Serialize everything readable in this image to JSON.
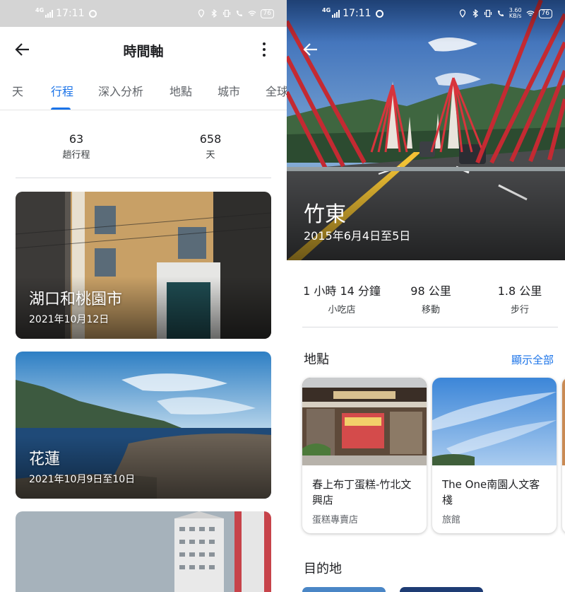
{
  "status_bar_left": {
    "network": "4G",
    "time": "17:11",
    "battery": "76"
  },
  "status_bar_right": {
    "network": "4G",
    "time": "17:11",
    "speed_value": "3.60",
    "speed_unit": "KB/s",
    "battery": "76"
  },
  "timeline": {
    "title": "時間軸",
    "tabs": [
      {
        "label": "天"
      },
      {
        "label": "行程",
        "active": true
      },
      {
        "label": "深入分析"
      },
      {
        "label": "地點"
      },
      {
        "label": "城市"
      },
      {
        "label": "全球"
      }
    ],
    "stats": [
      {
        "value": "63",
        "label": "趟行程"
      },
      {
        "value": "658",
        "label": "天"
      }
    ],
    "trips": [
      {
        "title": "湖口和桃園市",
        "date": "2021年10月12日"
      },
      {
        "title": "花蓮",
        "date": "2021年10月9日至10日"
      },
      {
        "title": "",
        "date": ""
      }
    ]
  },
  "trip_detail": {
    "title": "竹東",
    "date": "2015年6月4日至5日",
    "stats": [
      {
        "value": "1 小時 14 分鐘",
        "label": "小吃店"
      },
      {
        "value": "98 公里",
        "label": "移動"
      },
      {
        "value": "1.8 公里",
        "label": "步行"
      }
    ],
    "places_header": "地點",
    "show_all": "顯示全部",
    "places": [
      {
        "name": "春上布丁蛋糕-竹北文興店",
        "type": "蛋糕專賣店"
      },
      {
        "name": "The One南園人文客棧",
        "type": "旅館"
      }
    ],
    "destinations_header": "目的地"
  },
  "colors": {
    "accent": "#1a73e8",
    "bridge_red": "#d8343c"
  }
}
